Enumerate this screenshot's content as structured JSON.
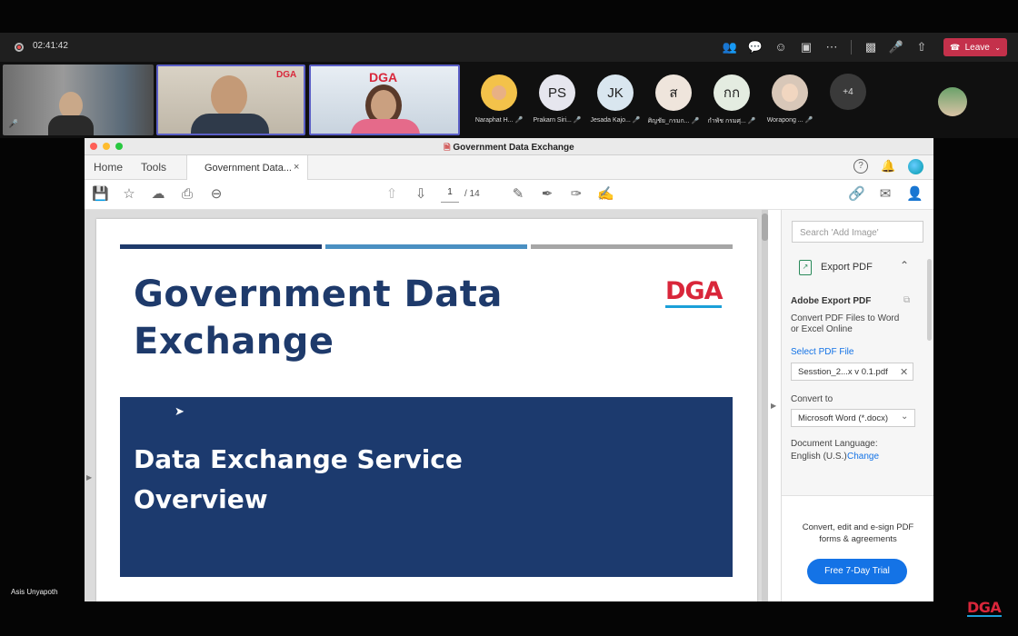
{
  "meeting": {
    "elapsed": "02:41:42",
    "leave_label": "Leave",
    "speaker_name": "Asis Unyapoth",
    "overflow_count": "+4",
    "participants": [
      {
        "initials": "",
        "name": "Naraphat H..."
      },
      {
        "initials": "PS",
        "name": "Prakarn Siri..."
      },
      {
        "initials": "JK",
        "name": "Jesada Kajo..."
      },
      {
        "initials": "ส",
        "name": "ศิญชัย_กรมก..."
      },
      {
        "initials": "กก",
        "name": "กำพัช กรมศุ..."
      },
      {
        "initials": "",
        "name": "Worapong ..."
      }
    ],
    "tile_logo": "DGA"
  },
  "acrobat": {
    "window_title": "Government Data Exchange",
    "menu": {
      "home": "Home",
      "tools": "Tools"
    },
    "tab_label": "Government Data...",
    "tab_close": "×",
    "page_current": "1",
    "page_total": "/ 14"
  },
  "document": {
    "title_line1": "Government Data",
    "title_line2": "Exchange",
    "logo_text": "DGA",
    "banner_line1": "Data Exchange Service",
    "banner_line2": "Overview",
    "stripe_colors": [
      "#1e3a6b",
      "#4a90c2",
      "#a6a6a6"
    ]
  },
  "right_pane": {
    "search_placeholder": "Search 'Add Image'",
    "export_title": "Export PDF",
    "service_title": "Adobe Export PDF",
    "description": "Convert PDF Files to Word or Excel Online",
    "select_file_label": "Select PDF File",
    "file_name": "Sesstion_2...x v 0.1.pdf",
    "convert_to_label": "Convert to",
    "convert_to_value": "Microsoft Word (*.docx)",
    "language_label": "Document Language:",
    "language_value": "English (U.S.)",
    "language_change": "Change",
    "promo_text": "Convert, edit and e-sign PDF forms & agreements",
    "trial_button": "Free 7-Day Trial"
  },
  "watermark": "DGA"
}
